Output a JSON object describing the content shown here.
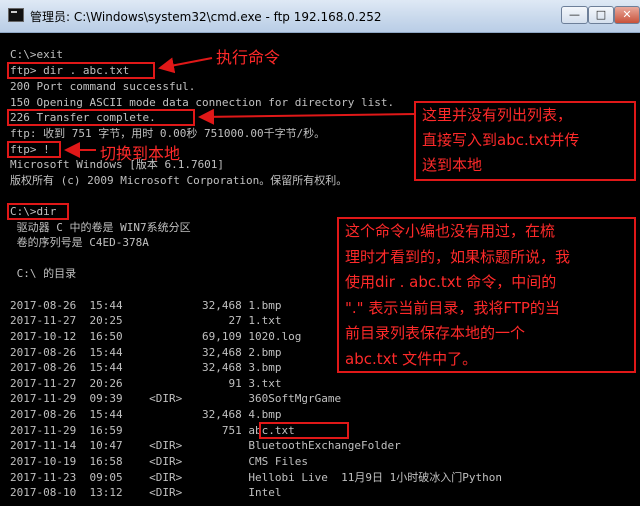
{
  "window": {
    "title": "管理员: C:\\Windows\\system32\\cmd.exe - ftp  192.168.0.252",
    "minimize_label": "—",
    "maximize_label": "□",
    "close_label": "✕"
  },
  "console_lines": [
    "C:\\>exit",
    "ftp> dir . abc.txt",
    "200 Port command successful.",
    "150 Opening ASCII mode data connection for directory list.",
    "226 Transfer complete.",
    "ftp: 收到 751 字节，用时 0.00秒 751000.00千字节/秒。",
    "ftp> !",
    "Microsoft Windows [版本 6.1.7601]",
    "版权所有 (c) 2009 Microsoft Corporation。保留所有权利。",
    "",
    "C:\\>dir",
    " 驱动器 C 中的卷是 WIN7系统分区",
    " 卷的序列号是 C4ED-378A",
    "",
    " C:\\ 的目录",
    "",
    "2017-08-26  15:44            32,468 1.bmp",
    "2017-11-27  20:25                27 1.txt",
    "2017-10-12  16:50            69,109 1020.log",
    "2017-08-26  15:44            32,468 2.bmp",
    "2017-08-26  15:44            32,468 3.bmp",
    "2017-11-27  20:26                91 3.txt",
    "2017-11-29  09:39    <DIR>          360SoftMgrGame",
    "2017-08-26  15:44            32,468 4.bmp",
    "2017-11-29  16:59               751 abc.txt",
    "2017-11-14  10:47    <DIR>          BluetoothExchangeFolder",
    "2017-10-19  16:58    <DIR>          CMS Files",
    "2017-11-23  09:05    <DIR>          Hellobi Live  11月9日 1小时破冰入门Python",
    "2017-08-10  13:12    <DIR>          Intel"
  ],
  "annotations": {
    "execute_command": "执行命令",
    "switch_local": "切换到本地",
    "no_listing_note": "这里并没有列出列表，\n直接写入到abc.txt并传\n送到本地",
    "explanation_note": "这个命令小编也没有用过，在梳\n理时才看到的，如果标题所说，我\n使用dir . abc.txt 命令，中间的\n\".\" 表示当前目录，我将FTP的当\n前目录列表保存本地的一个\nabc.txt 文件中了。"
  },
  "colors": {
    "console_bg": "#000000",
    "console_text": "#c0c0c0",
    "annotation_red": "#ff2a2a"
  }
}
